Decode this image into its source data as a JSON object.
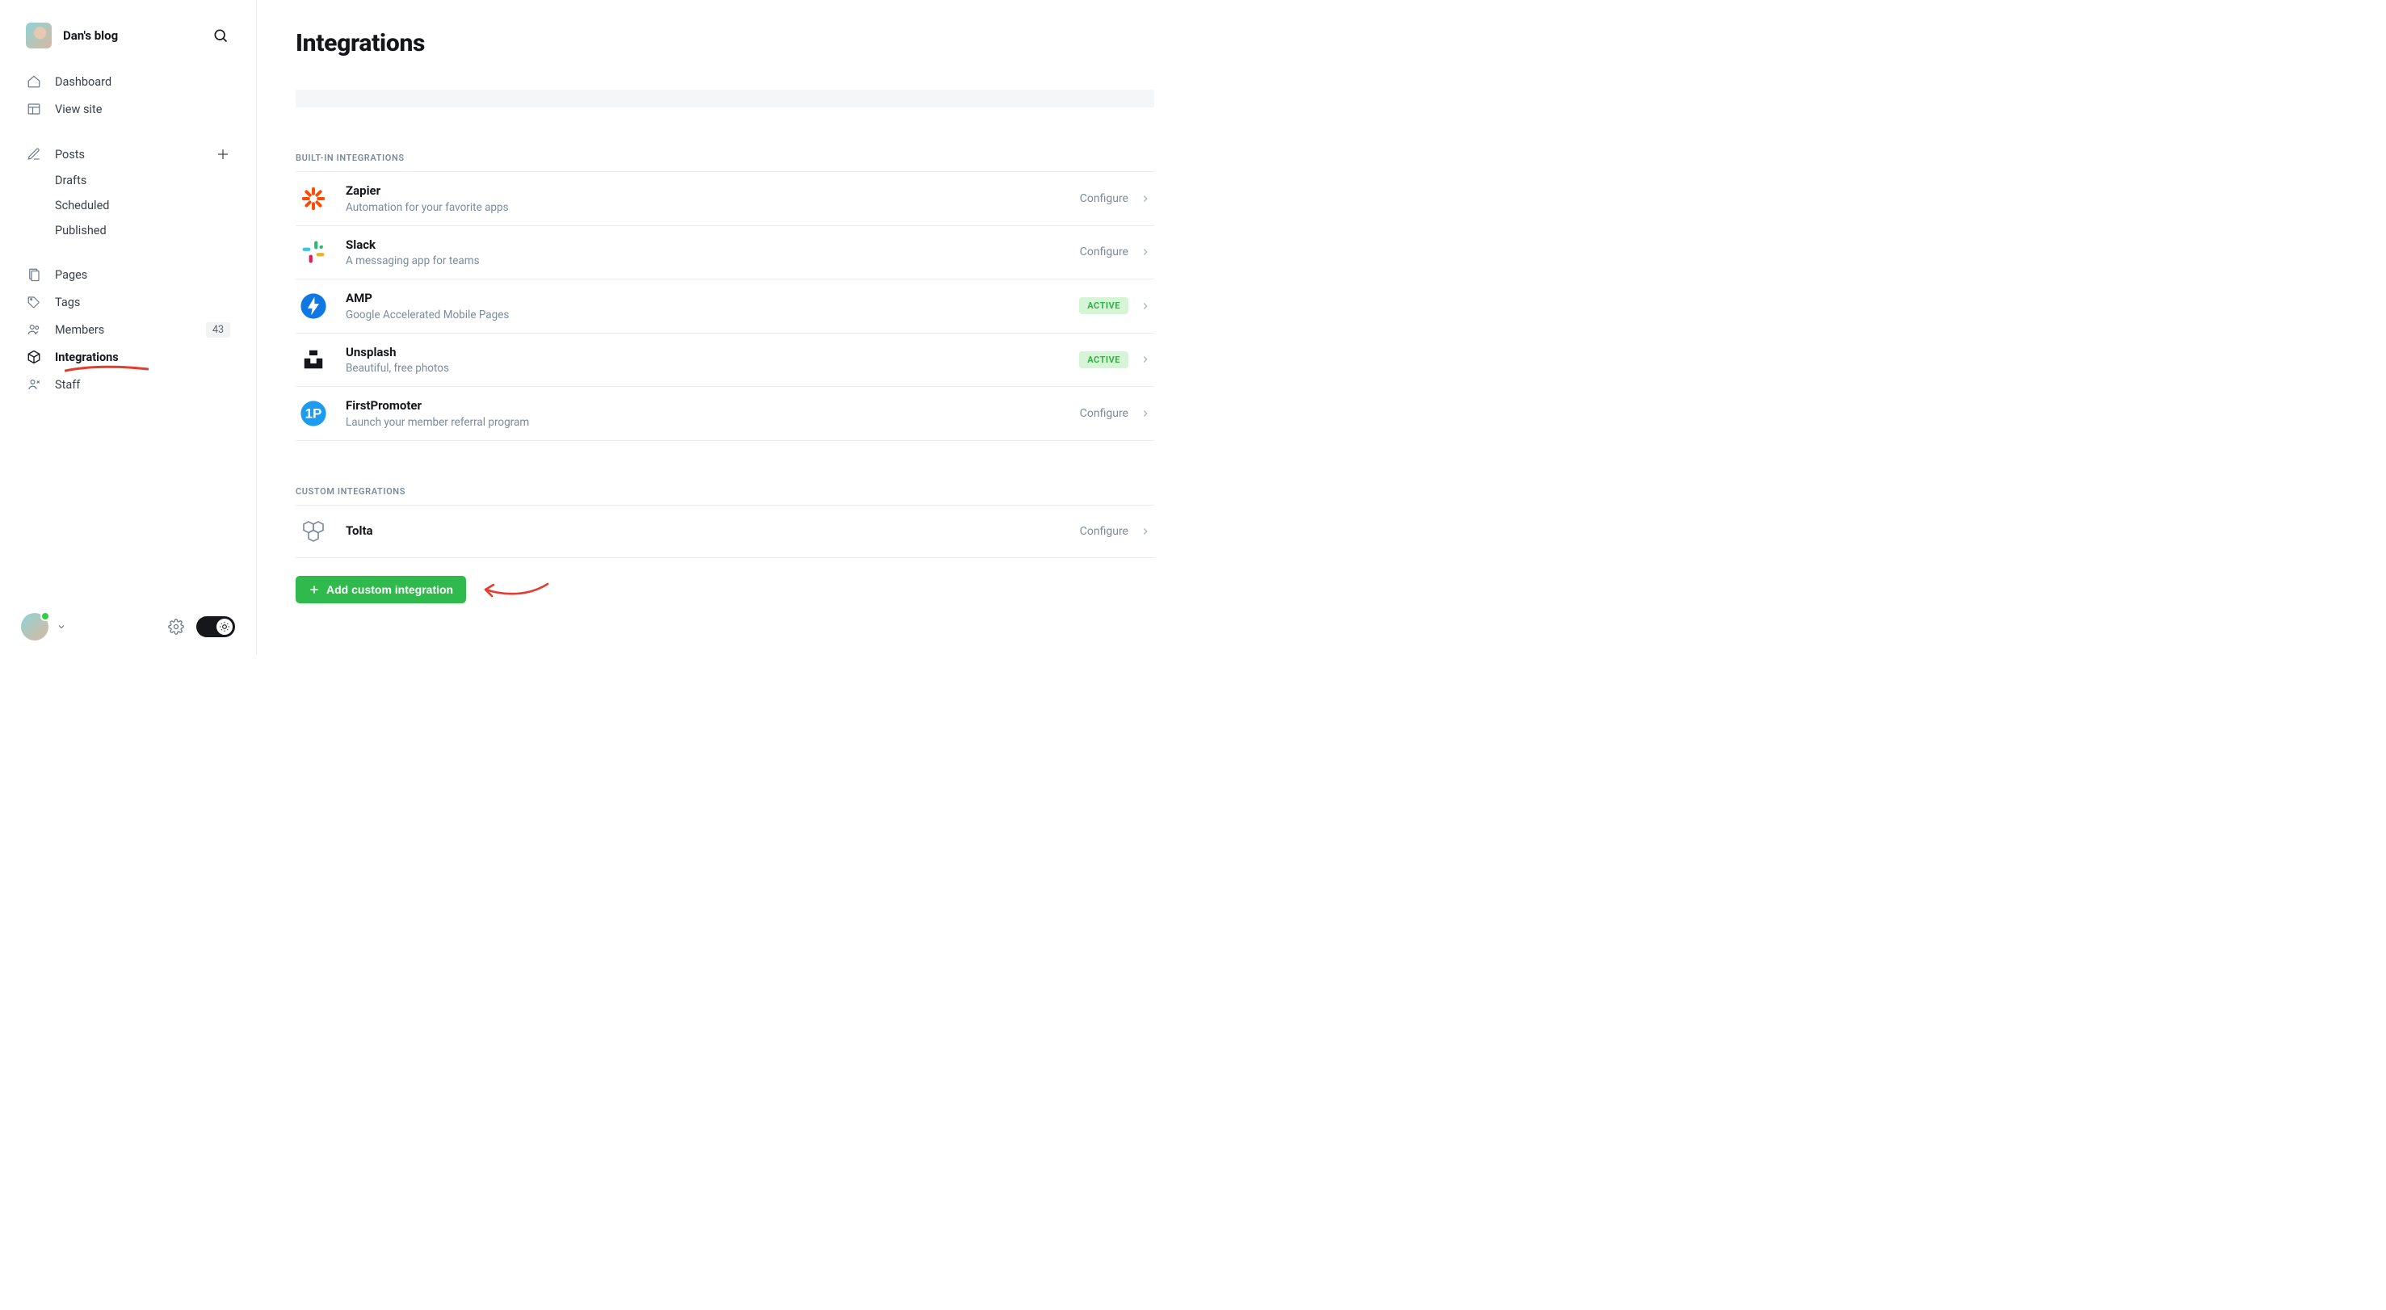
{
  "site": {
    "title": "Dan's blog"
  },
  "sidebar": {
    "dashboard": "Dashboard",
    "viewSite": "View site",
    "posts": "Posts",
    "drafts": "Drafts",
    "scheduled": "Scheduled",
    "published": "Published",
    "pages": "Pages",
    "tags": "Tags",
    "members": "Members",
    "membersCount": "43",
    "integrations": "Integrations",
    "staff": "Staff"
  },
  "page": {
    "title": "Integrations",
    "builtinLabel": "Built-in integrations",
    "customLabel": "Custom integrations",
    "configureText": "Configure",
    "activeText": "ACTIVE",
    "addButton": "Add custom integration"
  },
  "builtin": [
    {
      "name": "Zapier",
      "desc": "Automation for your favorite apps",
      "status": "configure"
    },
    {
      "name": "Slack",
      "desc": "A messaging app for teams",
      "status": "configure"
    },
    {
      "name": "AMP",
      "desc": "Google Accelerated Mobile Pages",
      "status": "active"
    },
    {
      "name": "Unsplash",
      "desc": "Beautiful, free photos",
      "status": "active"
    },
    {
      "name": "FirstPromoter",
      "desc": "Launch your member referral program",
      "status": "configure"
    }
  ],
  "custom": [
    {
      "name": "Tolta",
      "status": "configure"
    }
  ]
}
